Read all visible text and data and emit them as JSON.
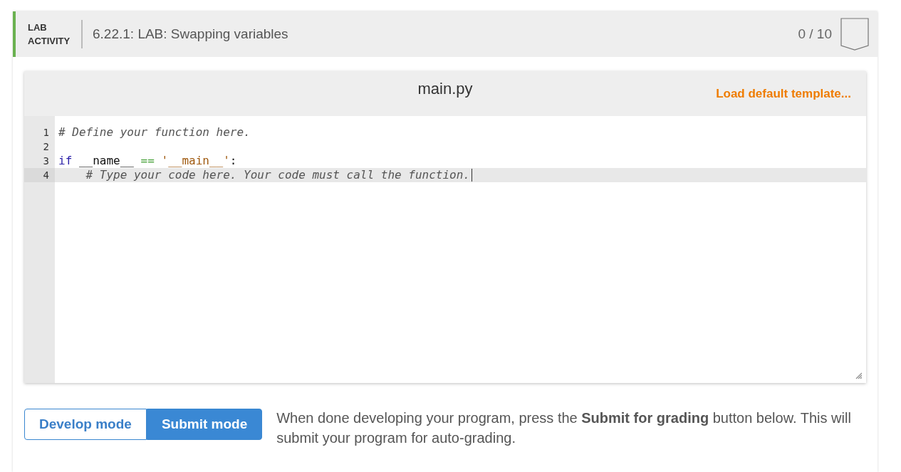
{
  "activity": {
    "label": "LAB ACTIVITY",
    "title": "6.22.1: LAB: Swapping variables",
    "score": "0 / 10"
  },
  "editor": {
    "filename": "main.py",
    "load_template": "Load default template...",
    "lines": [
      {
        "number": "1",
        "current": false,
        "tokens": [
          {
            "kind": "comment",
            "text": "# Define your function here."
          }
        ]
      },
      {
        "number": "2",
        "current": false
      },
      {
        "number": "3",
        "current": false,
        "tokens": [
          {
            "kind": "keyword",
            "text": "if"
          },
          {
            "kind": "plain",
            "text": " __name__ "
          },
          {
            "kind": "operator",
            "text": "== "
          },
          {
            "kind": "string",
            "text": "'__main__'"
          },
          {
            "kind": "plain",
            "text": ":"
          }
        ]
      },
      {
        "number": "4",
        "current": true,
        "tokens": [
          {
            "kind": "comment",
            "text": "    # Type your code here. Your code must call the function."
          }
        ]
      }
    ]
  },
  "modes": [
    {
      "label": "Develop mode",
      "selected": false
    },
    {
      "label": "Submit mode",
      "selected": true
    }
  ],
  "instructions": "When done developing your program, press the **Submit for grading** button below. This will submit your program for auto-grading."
}
